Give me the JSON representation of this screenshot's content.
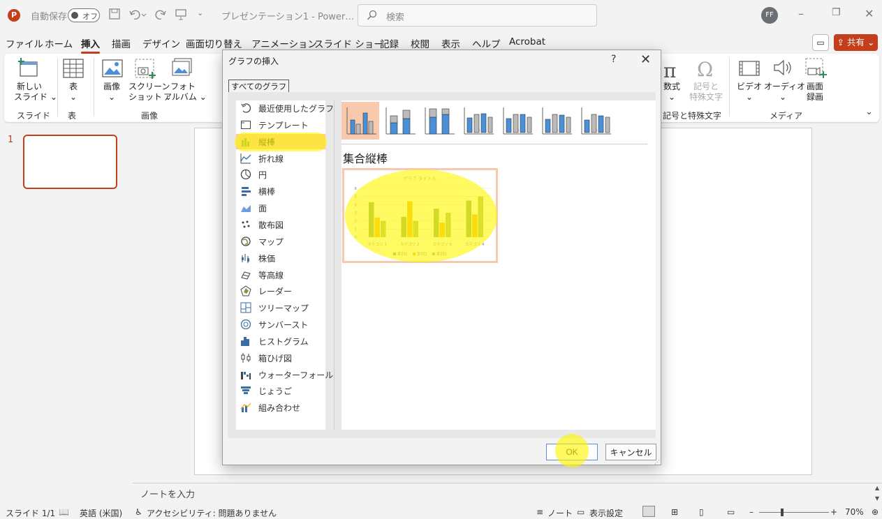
{
  "titlebar": {
    "autosave_label": "自動保存",
    "autosave_state": "オフ",
    "doc_title": "プレゼンテーション1 - Power…",
    "search_placeholder": "検索",
    "avatar": "FF"
  },
  "menu": [
    "ファイル",
    "ホーム",
    "挿入",
    "描画",
    "デザイン",
    "画面切り替え",
    "アニメーション",
    "スライド ショー",
    "記録",
    "校閲",
    "表示",
    "ヘルプ",
    "Acrobat"
  ],
  "share_label": "共有",
  "ribbon": {
    "new_slide": [
      "新しい",
      "スライド"
    ],
    "table": "表",
    "image": "画像",
    "screenshot": [
      "スクリーン",
      "ショット"
    ],
    "photo_album": [
      "フォト",
      "アルバム"
    ],
    "equation": "数式",
    "symbol": [
      "記号と",
      "特殊文字"
    ],
    "video": "ビデオ",
    "audio": "オーディオ",
    "screen_recording": [
      "画面",
      "録画"
    ],
    "groups": {
      "slides": "スライド",
      "tables": "表",
      "images": "画像",
      "symbols": "記号と特殊文字",
      "media": "メディア"
    }
  },
  "slide_panel": {
    "slide_number": "1"
  },
  "notes_placeholder": "ノートを入力",
  "statusbar": {
    "slide_info": "スライド 1/1",
    "language": "英語 (米国)",
    "accessibility": "アクセシビリティ: 問題ありません",
    "notes": "ノート",
    "display_settings": "表示設定",
    "zoom": "70%"
  },
  "dialog": {
    "title": "グラフの挿入",
    "help": "?",
    "tab": "すべてのグラフ",
    "chart_types": [
      {
        "label": "最近使用したグラフ",
        "icon": "recent-icon"
      },
      {
        "label": "テンプレート",
        "icon": "template-icon"
      },
      {
        "label": "縦棒",
        "icon": "column-chart-icon"
      },
      {
        "label": "折れ線",
        "icon": "line-chart-icon"
      },
      {
        "label": "円",
        "icon": "pie-chart-icon"
      },
      {
        "label": "横棒",
        "icon": "bar-chart-icon"
      },
      {
        "label": "面",
        "icon": "area-chart-icon"
      },
      {
        "label": "散布図",
        "icon": "scatter-chart-icon"
      },
      {
        "label": "マップ",
        "icon": "map-chart-icon"
      },
      {
        "label": "株価",
        "icon": "stock-chart-icon"
      },
      {
        "label": "等高線",
        "icon": "surface-chart-icon"
      },
      {
        "label": "レーダー",
        "icon": "radar-chart-icon"
      },
      {
        "label": "ツリーマップ",
        "icon": "treemap-chart-icon"
      },
      {
        "label": "サンバースト",
        "icon": "sunburst-chart-icon"
      },
      {
        "label": "ヒストグラム",
        "icon": "histogram-chart-icon"
      },
      {
        "label": "箱ひげ図",
        "icon": "boxwhisker-chart-icon"
      },
      {
        "label": "ウォーターフォール",
        "icon": "waterfall-chart-icon"
      },
      {
        "label": "じょうご",
        "icon": "funnel-chart-icon"
      },
      {
        "label": "組み合わせ",
        "icon": "combo-chart-icon"
      }
    ],
    "selected_type": "縦棒",
    "subtype_title": "集合縦棒",
    "ok": "OK",
    "cancel": "キャンセル"
  },
  "preview": {
    "title": "グラフ タイトル",
    "categories": [
      "カテゴリ 1",
      "カテゴリ 2",
      "カテゴリ 3",
      "カテゴリ 4"
    ],
    "y_ticks": [
      "0",
      "1",
      "2",
      "3",
      "4",
      "5",
      "6"
    ],
    "legend": [
      "系列1",
      "系列2",
      "系列3"
    ],
    "ylim": [
      0,
      6
    ],
    "series": [
      {
        "name": "系列1",
        "values": [
          4.3,
          2.5,
          3.5,
          4.5
        ],
        "color": "#8aab63"
      },
      {
        "name": "系列2",
        "values": [
          2.4,
          4.4,
          1.8,
          2.8
        ],
        "color": "#f2b21c"
      },
      {
        "name": "系列3",
        "values": [
          2,
          2,
          3,
          5
        ],
        "color": "#a9b96a"
      }
    ]
  },
  "colors": {
    "accent": "#c43e1c",
    "selection": "#f8c9ad",
    "highlight": "#fff700"
  }
}
